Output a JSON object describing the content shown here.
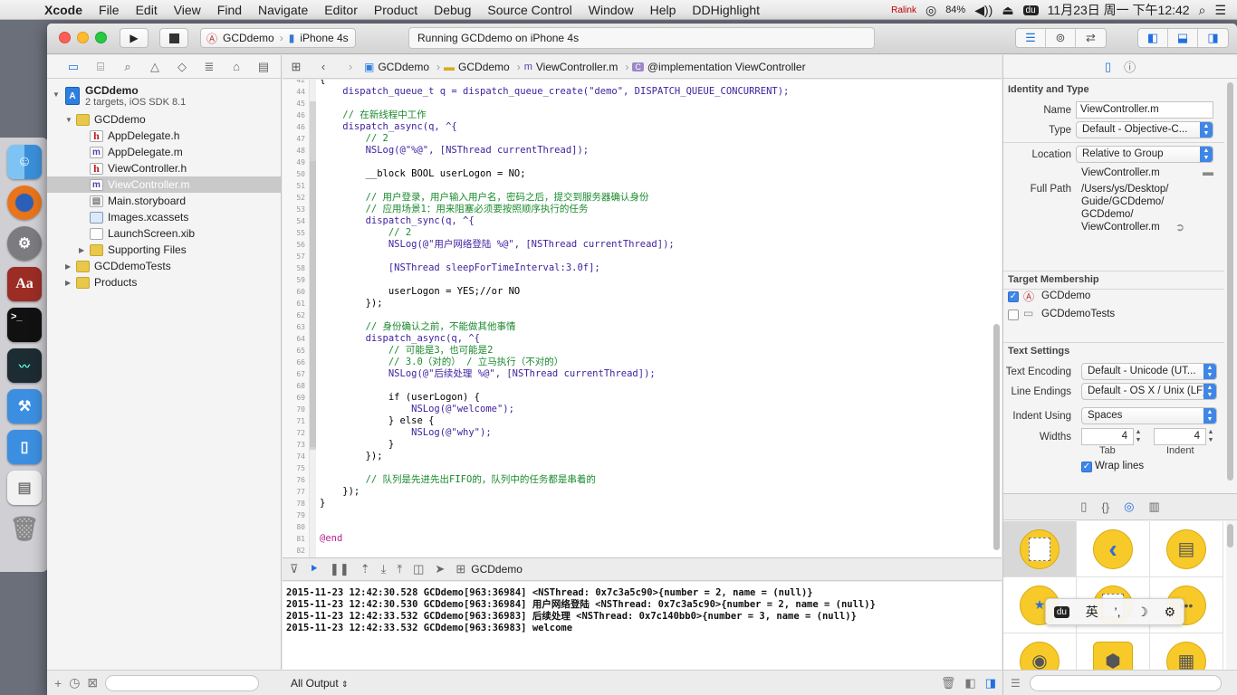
{
  "menubar": {
    "app_name": "Xcode",
    "items": [
      "File",
      "Edit",
      "View",
      "Find",
      "Navigate",
      "Editor",
      "Product",
      "Debug",
      "Source Control",
      "Window",
      "Help",
      "DDHighlight"
    ],
    "status": {
      "ralink": "Ralink",
      "battery": "84%",
      "input": "du",
      "datetime": "11月23日 周一 下午12:42"
    }
  },
  "dock": [
    "finder-icon",
    "firefox-icon",
    "system-preferences-icon",
    "dictionary-icon",
    "terminal-icon",
    "activity-monitor-icon",
    "xcode-icon",
    "simulator-icon",
    "document-icon",
    "trash-icon"
  ],
  "toolbar": {
    "scheme": "GCDdemo",
    "device": "iPhone 4s",
    "activity": "Running GCDdemo on iPhone 4s"
  },
  "navigator": {
    "project_name": "GCDdemo",
    "project_sub": "2 targets, iOS SDK 8.1",
    "items": [
      {
        "label": "GCDdemo",
        "type": "folder",
        "level": 1,
        "open": true
      },
      {
        "label": "AppDelegate.h",
        "type": "h",
        "level": 2
      },
      {
        "label": "AppDelegate.m",
        "type": "m",
        "level": 2
      },
      {
        "label": "ViewController.h",
        "type": "h",
        "level": 2
      },
      {
        "label": "ViewController.m",
        "type": "m",
        "level": 2,
        "selected": true
      },
      {
        "label": "Main.storyboard",
        "type": "sb",
        "level": 2
      },
      {
        "label": "Images.xcassets",
        "type": "xc",
        "level": 2
      },
      {
        "label": "LaunchScreen.xib",
        "type": "xib",
        "level": 2
      },
      {
        "label": "Supporting Files",
        "type": "folder",
        "level": 2,
        "open": false
      },
      {
        "label": "GCDdemoTests",
        "type": "folder",
        "level": 1,
        "open": false
      },
      {
        "label": "Products",
        "type": "folder",
        "level": 1,
        "open": false
      }
    ]
  },
  "jumpbar": {
    "crumbs": [
      "GCDdemo",
      "GCDdemo",
      "ViewController.m",
      "@implementation ViewController"
    ]
  },
  "editor": {
    "lines": [
      {
        "n": "42",
        "t": "{"
      },
      {
        "n": "44",
        "t": "    dispatch_queue_t q = dispatch_queue_create(\"demo\", DISPATCH_QUEUE_CONCURRENT);"
      },
      {
        "n": "45",
        "t": ""
      },
      {
        "n": "46",
        "t": "    // 在新线程中工作"
      },
      {
        "n": "46",
        "t": "    dispatch_async(q, ^{"
      },
      {
        "n": "47",
        "t": "        // 2"
      },
      {
        "n": "48",
        "t": "        NSLog(@\"%@\", [NSThread currentThread]);"
      },
      {
        "n": "49",
        "t": ""
      },
      {
        "n": "50",
        "t": "        __block BOOL userLogon = NO;"
      },
      {
        "n": "51",
        "t": ""
      },
      {
        "n": "52",
        "t": "        // 用户登录，用户输入用户名，密码之后，提交到服务器确认身份"
      },
      {
        "n": "53",
        "t": "        // 应用场景1：用来阻塞必须要按照顺序执行的任务"
      },
      {
        "n": "54",
        "t": "        dispatch_sync(q, ^{"
      },
      {
        "n": "55",
        "t": "            // 2"
      },
      {
        "n": "56",
        "t": "            NSLog(@\"用户网络登陆 %@\", [NSThread currentThread]);"
      },
      {
        "n": "57",
        "t": ""
      },
      {
        "n": "58",
        "t": "            [NSThread sleepForTimeInterval:3.0f];"
      },
      {
        "n": "59",
        "t": ""
      },
      {
        "n": "60",
        "t": "            userLogon = YES;//or NO"
      },
      {
        "n": "61",
        "t": "        });"
      },
      {
        "n": "62",
        "t": ""
      },
      {
        "n": "63",
        "t": "        // 身份确认之前，不能做其他事情"
      },
      {
        "n": "64",
        "t": "        dispatch_async(q, ^{"
      },
      {
        "n": "65",
        "t": "            // 可能是3，也可能是2"
      },
      {
        "n": "66",
        "t": "            // 3.0（对的） / 立马执行（不对的）"
      },
      {
        "n": "67",
        "t": "            NSLog(@\"后续处理 %@\", [NSThread currentThread]);"
      },
      {
        "n": "68",
        "t": ""
      },
      {
        "n": "69",
        "t": "            if (userLogon) {"
      },
      {
        "n": "70",
        "t": "                NSLog(@\"welcome\");"
      },
      {
        "n": "71",
        "t": "            } else {"
      },
      {
        "n": "72",
        "t": "                NSLog(@\"why\");"
      },
      {
        "n": "73",
        "t": "            }"
      },
      {
        "n": "74",
        "t": "        });"
      },
      {
        "n": "75",
        "t": ""
      },
      {
        "n": "76",
        "t": "        // 队列是先进先出FIFO的，队列中的任务都是串着的"
      },
      {
        "n": "77",
        "t": "    });"
      },
      {
        "n": "78",
        "t": "}"
      },
      {
        "n": "79",
        "t": ""
      },
      {
        "n": "80",
        "t": ""
      },
      {
        "n": "81",
        "t": "@end"
      },
      {
        "n": "82",
        "t": ""
      }
    ]
  },
  "debug": {
    "target": "GCDdemo",
    "output_filter": "All Output",
    "console": [
      "2015-11-23 12:42:30.528 GCDdemo[963:36984] <NSThread: 0x7c3a5c90>{number = 2, name = (null)}",
      "2015-11-23 12:42:30.530 GCDdemo[963:36984] 用户网络登陆 <NSThread: 0x7c3a5c90>{number = 2, name = (null)}",
      "2015-11-23 12:42:33.532 GCDdemo[963:36983] 后续处理 <NSThread: 0x7c140bb0>{number = 3, name = (null)}",
      "2015-11-23 12:42:33.532 GCDdemo[963:36983] welcome"
    ]
  },
  "inspector": {
    "identity_title": "Identity and Type",
    "name_label": "Name",
    "name_value": "ViewController.m",
    "type_label": "Type",
    "type_value": "Default - Objective-C...",
    "location_label": "Location",
    "location_value": "Relative to Group",
    "location_file": "ViewController.m",
    "fullpath_label": "Full Path",
    "fullpath_lines": [
      "/Users/ys/Desktop/",
      "Guide/GCDdemo/",
      "GCDdemo/",
      "ViewController.m"
    ],
    "membership_title": "Target Membership",
    "targets": [
      {
        "label": "GCDdemo",
        "checked": true
      },
      {
        "label": "GCDdemoTests",
        "checked": false
      }
    ],
    "text_title": "Text Settings",
    "encoding_label": "Text Encoding",
    "encoding_value": "Default - Unicode (UT...",
    "endings_label": "Line Endings",
    "endings_value": "Default - OS X / Unix (LF)",
    "indent_label": "Indent Using",
    "indent_value": "Spaces",
    "widths_label": "Widths",
    "tab_value": "4",
    "indent_width_value": "4",
    "tab_caption": "Tab",
    "indent_caption": "Indent",
    "wrap_label": "Wrap lines",
    "wrap_checked": true
  },
  "ime": [
    "du",
    "英",
    "’,",
    "☽",
    "⚙"
  ]
}
